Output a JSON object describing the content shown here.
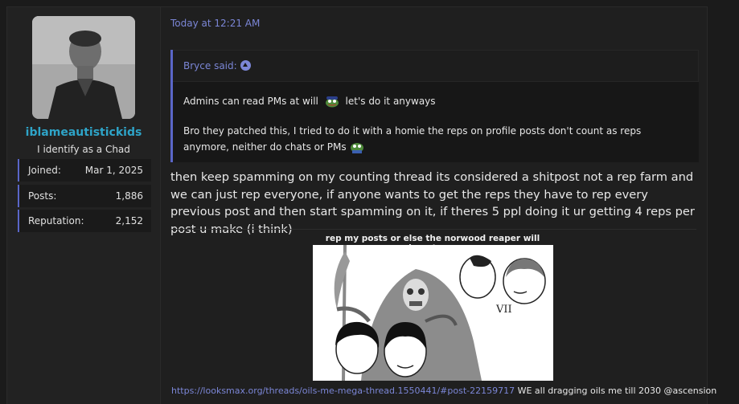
{
  "user": {
    "name": "iblameautistickids",
    "title": "I identify as a Chad",
    "stats": [
      {
        "label": "Joined:",
        "value": "Mar 1, 2025"
      },
      {
        "label": "Posts:",
        "value": "1,886"
      },
      {
        "label": "Reputation:",
        "value": "2,152"
      }
    ]
  },
  "post": {
    "timestamp": "Today at 12:21 AM",
    "quote": {
      "author": "Bryce said:",
      "line1_a": "Admins can read PMs at will",
      "line1_b": "let's do it anyways",
      "line2": "Bro they patched this, I tried to do it with a homie the reps on profile posts don't count as reps anymore, neither do chats or PMs"
    },
    "body": "then keep spamming on my counting thread its considered a shitpost not a rep farm and we can just rep everyone, if anyone wants to get the reps they have to rep every previous post and then start spamming on it, if theres 5 ppl doing it ur getting 4 reps per post u make (i think)"
  },
  "signature": {
    "caption": "rep my posts or else the norwood reaper will haunt you",
    "image_label": "VII",
    "link": "https://looksmax.org/threads/oils-me-mega-thread.1550441/#post-22159717",
    "text": " WE all dragging oils me till 2030 @ascension"
  },
  "colors": {
    "accent": "#5a66c8",
    "link": "#7b86d6",
    "username": "#2ea4c8"
  }
}
